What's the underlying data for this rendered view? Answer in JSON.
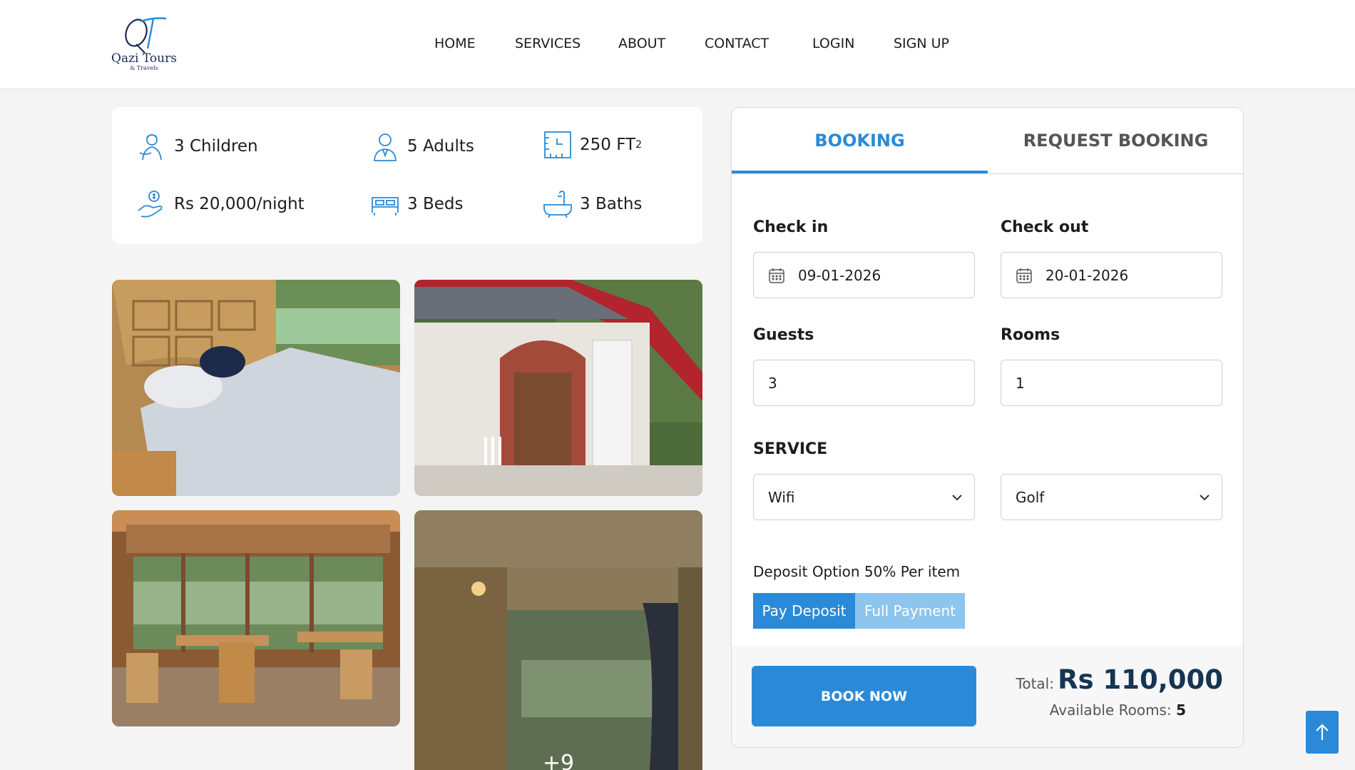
{
  "brand": {
    "name": "Qazi Tours",
    "sub": "& Travels",
    "monogram": "QT"
  },
  "nav": [
    "HOME",
    "SERVICES",
    "ABOUT",
    "CONTACT",
    "LOGIN",
    "SIGN UP"
  ],
  "amenities": {
    "children": "3 Children",
    "adults": "5 Adults",
    "area": "250 FT",
    "area_sup": "2",
    "price": "Rs 20,000/night",
    "beds": "3 Beds",
    "baths": "3 Baths"
  },
  "gallery": {
    "more_label": "+9"
  },
  "booking": {
    "tabs": [
      "BOOKING",
      "REQUEST BOOKING"
    ],
    "checkin_label": "Check in",
    "checkin_value": "09-01-2026",
    "checkout_label": "Check out",
    "checkout_value": "20-01-2026",
    "guests_label": "Guests",
    "guests_value": "3",
    "rooms_label": "Rooms",
    "rooms_value": "1",
    "service_label": "SERVICE",
    "service_1": "Wifi",
    "service_2": "Golf",
    "deposit_text": "Deposit Option 50% Per item",
    "pay_deposit": "Pay Deposit",
    "full_payment": "Full Payment",
    "book_now": "BOOK NOW",
    "total_label": "Total:",
    "total_value": "Rs 110,000",
    "available_label": "Available Rooms:",
    "available_value": "5"
  },
  "colors": {
    "accent": "#2a8ad8",
    "accent_light": "#8cc5ee",
    "total": "#163554"
  },
  "icons": [
    "children-icon",
    "adults-icon",
    "area-icon",
    "price-icon",
    "bed-icon",
    "bath-icon",
    "calendar-icon",
    "chevron-down-icon",
    "arrow-up-icon"
  ]
}
